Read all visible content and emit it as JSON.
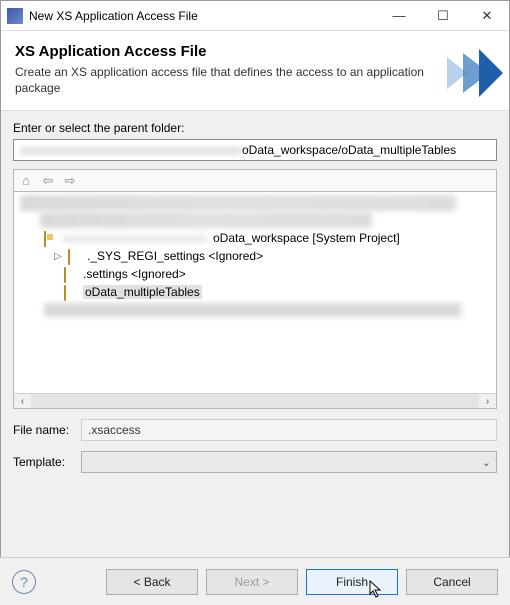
{
  "window": {
    "title": "New XS Application Access File"
  },
  "header": {
    "title": "XS Application Access File",
    "description": "Create an XS application access file that defines the access to an application package"
  },
  "parent": {
    "label": "Enter or select the parent folder:",
    "value_suffix": "oData_workspace/oData_multipleTables"
  },
  "tree": {
    "workspace_label": "oData_workspace [System Project]",
    "items": [
      {
        "label": "._SYS_REGI_settings <Ignored>"
      },
      {
        "label": ".settings <Ignored>"
      },
      {
        "label": "oData_multipleTables"
      }
    ]
  },
  "file": {
    "label": "File name:",
    "value": ".xsaccess"
  },
  "template": {
    "label": "Template:"
  },
  "buttons": {
    "back": "< Back",
    "next": "Next >",
    "finish": "Finish",
    "cancel": "Cancel"
  }
}
